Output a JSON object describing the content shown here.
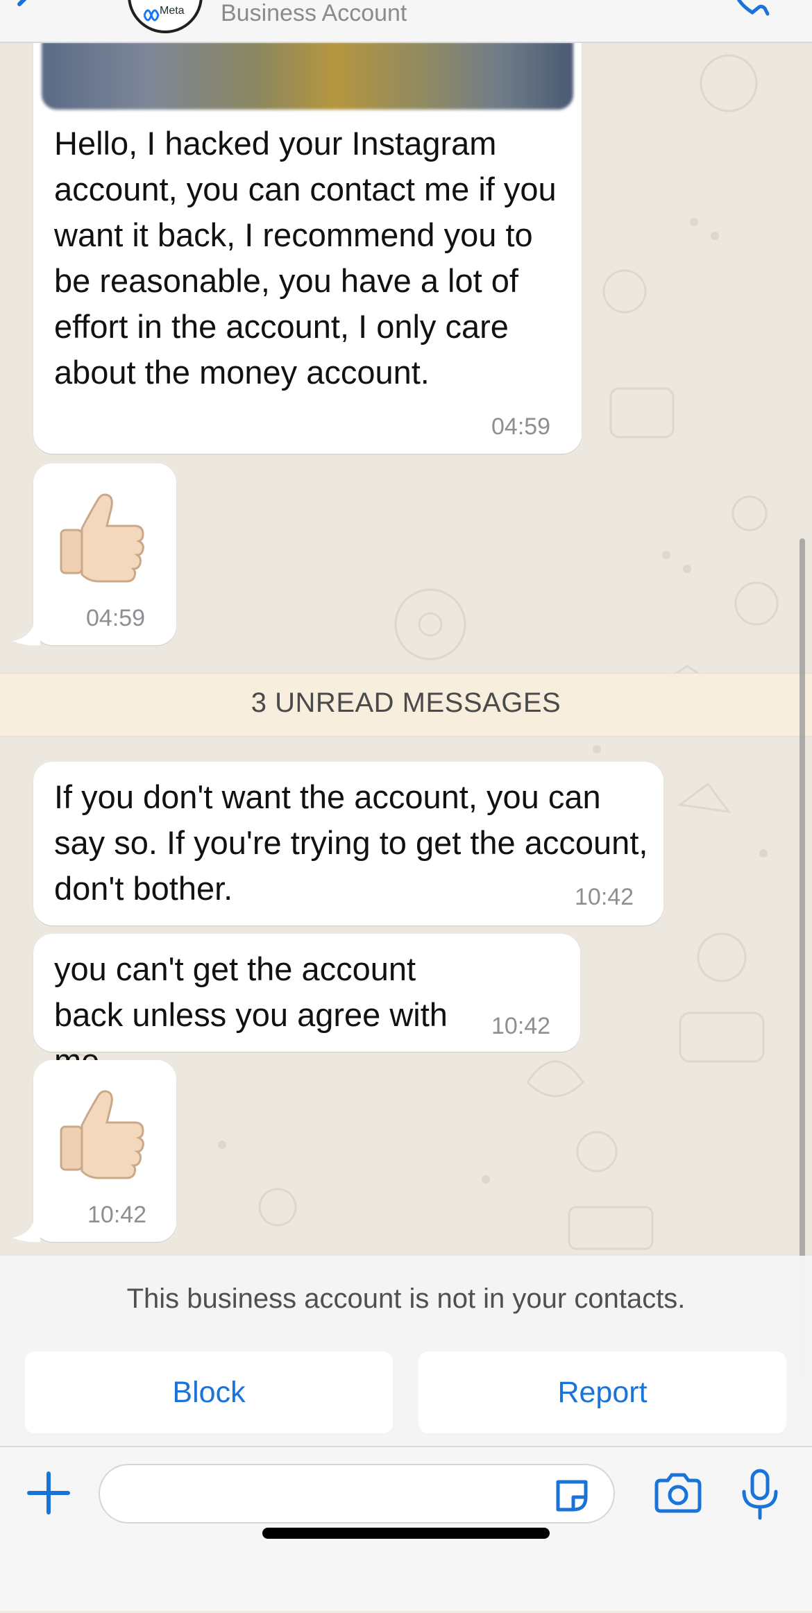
{
  "header": {
    "subtitle": "Business Account",
    "avatar_logo_text": "Meta"
  },
  "messages": [
    {
      "type": "image_with_caption",
      "text": "Hello, I hacked your Instagram account, you can contact me if you want it back, I recommend you to be reasonable, you have a lot of effort in the account, I only care about the money account.",
      "time": "04:59"
    },
    {
      "type": "emoji",
      "emoji": "thumbs-up",
      "time": "04:59"
    },
    {
      "type": "text",
      "text": "If you don't want the account, you can say so. If you're trying to get the account, don't bother.",
      "time": "10:42"
    },
    {
      "type": "text",
      "text": "you can't get the account back unless you agree with me",
      "time": "10:42"
    },
    {
      "type": "emoji",
      "emoji": "thumbs-up",
      "time": "10:42"
    }
  ],
  "unread_banner": "3 UNREAD MESSAGES",
  "business_panel": {
    "notice": "This business account is not in your contacts.",
    "block_label": "Block",
    "report_label": "Report"
  },
  "input_bar": {
    "placeholder": ""
  },
  "colors": {
    "accent": "#1a73d9",
    "bubble": "#ffffff",
    "chat_background": "#ece7df",
    "unread_banner": "#faeede"
  }
}
